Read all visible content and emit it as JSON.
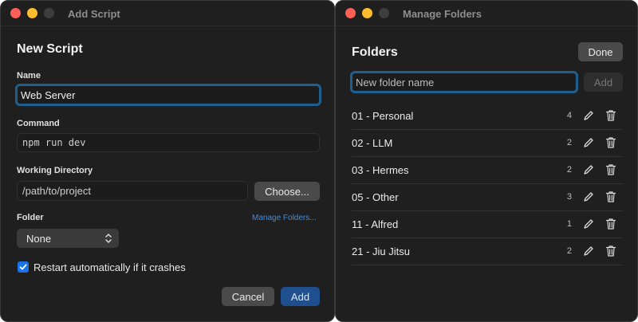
{
  "left_window": {
    "title": "Add Script",
    "heading": "New Script",
    "name": {
      "label": "Name",
      "value": "Web Server"
    },
    "command": {
      "label": "Command",
      "value": "npm run dev"
    },
    "working_directory": {
      "label": "Working Directory",
      "value": "/path/to/project",
      "choose_button": "Choose..."
    },
    "folder": {
      "label": "Folder",
      "manage_link": "Manage Folders...",
      "selected": "None"
    },
    "restart_checkbox": {
      "label": "Restart automatically if it crashes",
      "checked": true
    },
    "cancel_button": "Cancel",
    "add_button": "Add"
  },
  "right_window": {
    "title": "Manage Folders",
    "heading": "Folders",
    "done_button": "Done",
    "new_folder_placeholder": "New folder name",
    "add_button": "Add",
    "folders": [
      {
        "name": "01 - Personal",
        "count": "4"
      },
      {
        "name": "02 - LLM",
        "count": "2"
      },
      {
        "name": "03 - Hermes",
        "count": "2"
      },
      {
        "name": "05 - Other",
        "count": "3"
      },
      {
        "name": "11 - Alfred",
        "count": "1"
      },
      {
        "name": "21 - Jiu Jitsu",
        "count": "2"
      }
    ]
  },
  "colors": {
    "window_bg": "#1f1f1f",
    "accent_blue": "#1a74e8",
    "focus_ring": "#1f5f8f",
    "link": "#3b8ee8",
    "close": "#ff5f57",
    "minimize": "#febc2e"
  },
  "icons": {
    "edit": "pencil-icon",
    "delete": "trash-icon",
    "select": "chevron-updown-icon",
    "check": "checkmark-icon"
  }
}
